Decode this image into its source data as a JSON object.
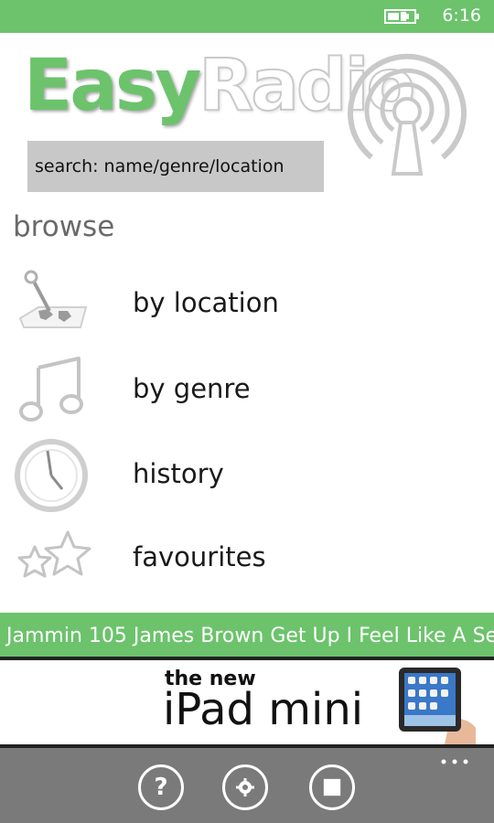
{
  "status_bar": {
    "time": "6:16",
    "icons": [
      "battery-charging-icon"
    ],
    "background": "#6cc36c"
  },
  "header": {
    "logo_part1": "Easy",
    "logo_part2": "Radio",
    "logo_icon": "radio-antenna-icon"
  },
  "search": {
    "placeholder": "search: name/genre/location"
  },
  "browse": {
    "title": "browse",
    "items": [
      {
        "label": "by location",
        "icon": "map-pin-icon"
      },
      {
        "label": "by genre",
        "icon": "music-note-icon"
      },
      {
        "label": "history",
        "icon": "clock-icon"
      },
      {
        "label": "favourites",
        "icon": "stars-icon"
      }
    ]
  },
  "now_playing": {
    "station": "Jammin 105",
    "artist": "James Brown",
    "song": "Get Up I Feel Like A Se",
    "background": "#6cc36c"
  },
  "ad": {
    "line1": "the new",
    "line2": "iPad mini"
  },
  "app_bar": {
    "buttons": [
      {
        "label": "?",
        "icon": "help-icon"
      },
      {
        "label": "",
        "icon": "settings-gear-icon"
      },
      {
        "label": "",
        "icon": "stop-icon"
      }
    ],
    "more_icon": "ellipsis-icon",
    "background": "#7a7a7a"
  }
}
